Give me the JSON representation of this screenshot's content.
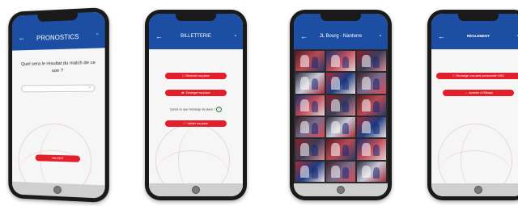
{
  "phones": [
    {
      "title": "PRONOSTICS",
      "question": "Quel sera le résultat du match de ce soir ?",
      "select_value": "",
      "submit_label": "VALIDER"
    },
    {
      "title": "BILLETTERIE",
      "buttons": [
        "Réserver ma place",
        "Echanger ma place",
        "Valider ma place"
      ],
      "exchange_text": "Qu'est ce que l'échange de place ?"
    },
    {
      "title": "JL Bourg - Nanterre",
      "photo_count": 18
    },
    {
      "title": "RÉGLEMENT",
      "buttons": [
        "Recharger ma carte personnelle VISO",
        "Accéder à l'Elikaya"
      ]
    }
  ],
  "icons": {
    "back": "arrow-left-icon",
    "trash": "trash-icon",
    "home": "home-button-icon",
    "help": "help-circle-icon"
  },
  "colors": {
    "header": "#1c4ea3",
    "button": "#e1202c",
    "phone_frame": "#1a1a1a"
  }
}
